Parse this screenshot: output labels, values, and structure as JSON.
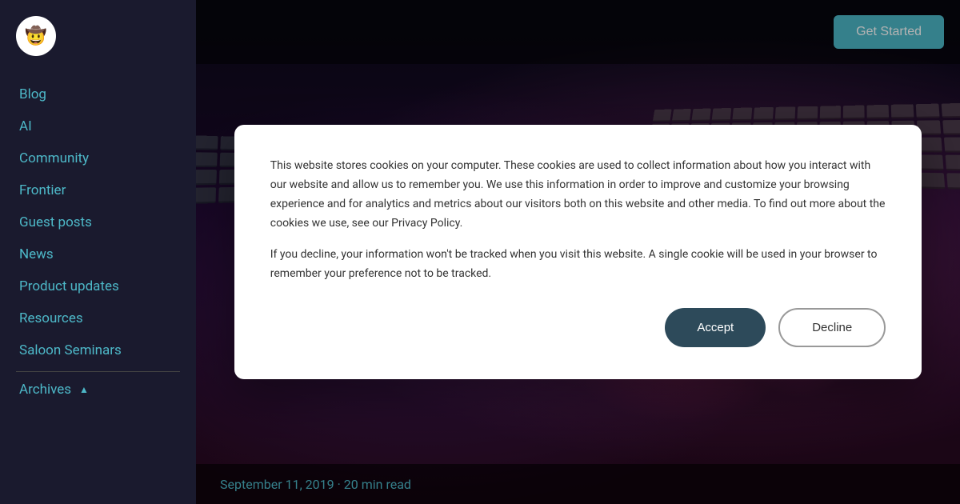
{
  "sidebar": {
    "logo": {
      "icon": "🤠",
      "alt": "cowboy hat logo"
    },
    "nav_items": [
      {
        "id": "blog",
        "label": "Blog"
      },
      {
        "id": "ai",
        "label": "AI"
      },
      {
        "id": "community",
        "label": "Community"
      },
      {
        "id": "frontier",
        "label": "Frontier"
      },
      {
        "id": "guest-posts",
        "label": "Guest posts"
      },
      {
        "id": "news",
        "label": "News"
      },
      {
        "id": "product-updates",
        "label": "Product updates"
      },
      {
        "id": "resources",
        "label": "Resources"
      },
      {
        "id": "saloon-seminars",
        "label": "Saloon Seminars"
      },
      {
        "id": "archives",
        "label": "Archives",
        "has_chevron": true
      }
    ]
  },
  "header": {
    "cta_button": "Get Started"
  },
  "hero": {
    "date": "September 11, 2019",
    "read_time": "20 min read",
    "separator": "·"
  },
  "cookie_modal": {
    "paragraph1": "This website stores cookies on your computer. These cookies are used to collect information about how you interact with our website and allow us to remember you. We use this information in order to improve and customize your browsing experience and for analytics and metrics about our visitors both on this website and other media. To find out more about the cookies we use, see our Privacy Policy.",
    "paragraph2": "If you decline, your information won't be tracked when you visit this website. A single cookie will be used in your browser to remember your preference not to be tracked.",
    "accept_label": "Accept",
    "decline_label": "Decline"
  }
}
